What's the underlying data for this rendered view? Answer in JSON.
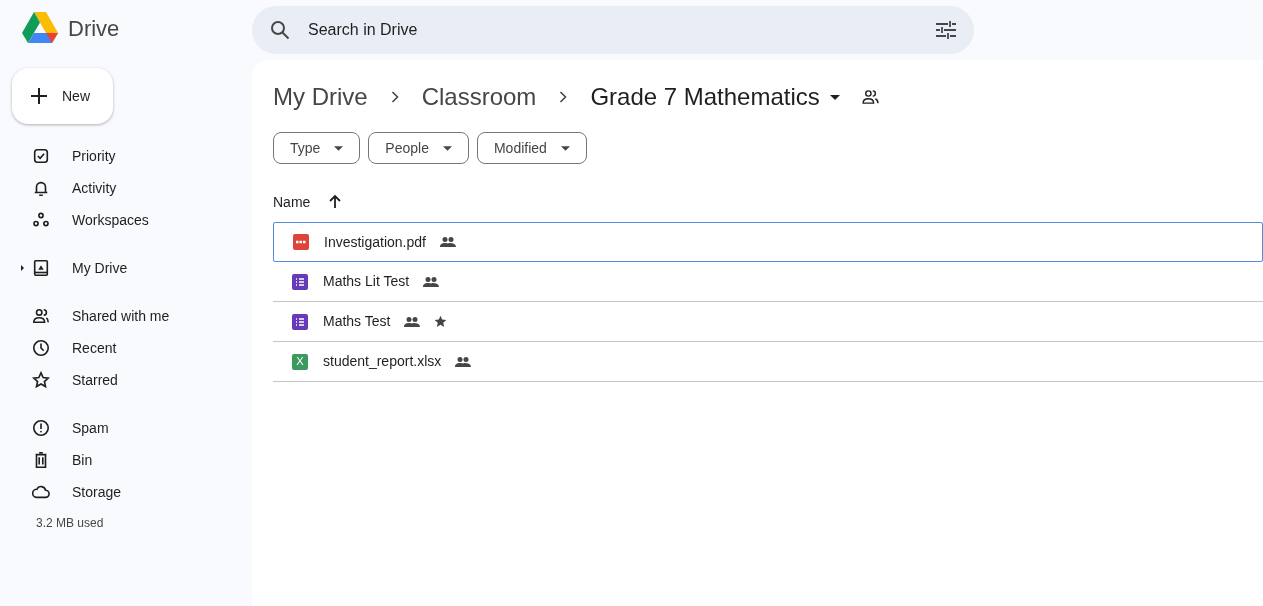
{
  "app": {
    "title": "Drive"
  },
  "search": {
    "placeholder": "Search in Drive"
  },
  "new_button": {
    "label": "New"
  },
  "sidebar": {
    "groups": [
      [
        {
          "label": "Priority"
        },
        {
          "label": "Activity"
        },
        {
          "label": "Workspaces"
        }
      ],
      [
        {
          "label": "My Drive",
          "expandable": true
        }
      ],
      [
        {
          "label": "Shared with me"
        },
        {
          "label": "Recent"
        },
        {
          "label": "Starred"
        }
      ],
      [
        {
          "label": "Spam"
        },
        {
          "label": "Bin"
        },
        {
          "label": "Storage"
        }
      ]
    ],
    "storage_used": "3.2 MB used"
  },
  "breadcrumbs": [
    {
      "label": "My Drive",
      "current": false
    },
    {
      "label": "Classroom",
      "current": false
    },
    {
      "label": "Grade 7 Mathematics",
      "current": true
    }
  ],
  "filters": [
    "Type",
    "People",
    "Modified"
  ],
  "table": {
    "columns": [
      {
        "label": "Name"
      }
    ],
    "rows": [
      {
        "kind": "pdf",
        "name": "Investigation.pdf",
        "shared": true,
        "starred": false,
        "selected": true
      },
      {
        "kind": "form",
        "name": "Maths Lit Test",
        "shared": true,
        "starred": false,
        "selected": false
      },
      {
        "kind": "form",
        "name": "Maths Test",
        "shared": true,
        "starred": true,
        "selected": false
      },
      {
        "kind": "sheet",
        "icon_label": "X",
        "name": "student_report.xlsx",
        "shared": true,
        "starred": false,
        "selected": false
      }
    ]
  }
}
